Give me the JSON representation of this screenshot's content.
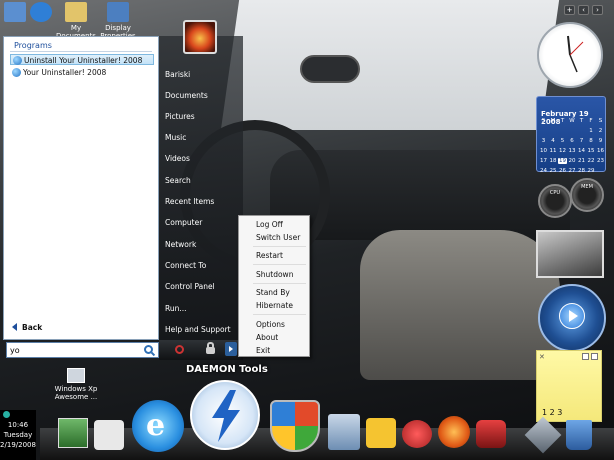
{
  "desktop": {
    "top_icons": [
      {
        "label": "",
        "icon": "recycle-bin-icon"
      },
      {
        "label": "",
        "icon": "ie-icon"
      },
      {
        "label": "My\nDocuments",
        "icon": "folder-icon"
      },
      {
        "label": "Display\nProperties",
        "icon": "display-icon"
      }
    ],
    "bottom_icon_label": "Windows Xp\nAwesome ...",
    "daemon_label": "DAEMON Tools"
  },
  "start_menu": {
    "programs_header": "Programs",
    "programs": [
      {
        "label": "Uninstall Your Uninstaller! 2008",
        "selected": true
      },
      {
        "label": "Your Uninstaller! 2008",
        "selected": false
      }
    ],
    "back_label": "Back",
    "search_value": "yo",
    "right_items": [
      "Bariski",
      "Documents",
      "Pictures",
      "Music",
      "Videos",
      "Search",
      "Recent Items",
      "Computer",
      "Network",
      "Connect To",
      "Control Panel",
      "Run...",
      "Help and Support"
    ]
  },
  "power_menu": {
    "items": [
      "Log Off",
      "Switch User",
      "Restart",
      "Shutdown",
      "Stand By",
      "Hibernate",
      "Options",
      "About",
      "Exit"
    ]
  },
  "clock": {
    "time": "10:46",
    "day": "Tuesday",
    "date": "2/19/2008"
  },
  "calendar": {
    "title": "February 19  2008",
    "weekdays": [
      "S",
      "M",
      "T",
      "W",
      "T",
      "F",
      "S"
    ],
    "weeks": [
      [
        "",
        "",
        "",
        "",
        "",
        "1",
        "2"
      ],
      [
        "3",
        "4",
        "5",
        "6",
        "7",
        "8",
        "9"
      ],
      [
        "10",
        "11",
        "12",
        "13",
        "14",
        "15",
        "16"
      ],
      [
        "17",
        "18",
        "19",
        "20",
        "21",
        "22",
        "23"
      ],
      [
        "24",
        "25",
        "26",
        "27",
        "28",
        "29",
        ""
      ]
    ],
    "today": "19"
  },
  "gauges": {
    "left_label": "CPU",
    "right_label": "MEM"
  },
  "notes": {
    "text": "1 2 3"
  },
  "colors": {
    "accent": "#1e4f9c",
    "calendar_bg": "#2a56a7",
    "notes_bg": "#fff9a6"
  }
}
